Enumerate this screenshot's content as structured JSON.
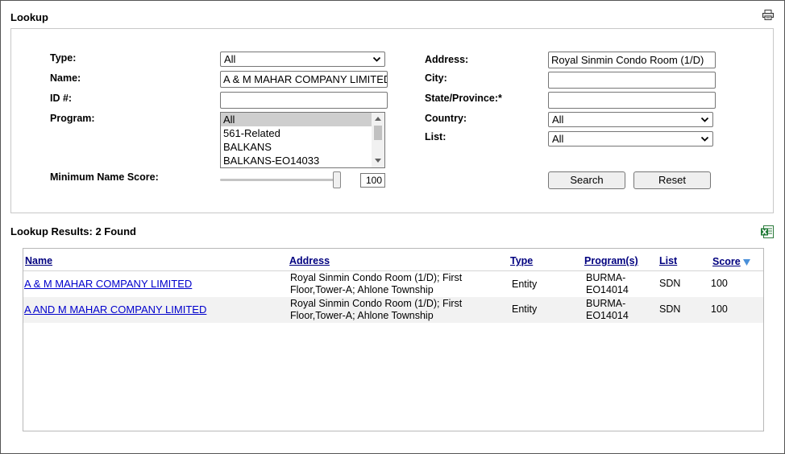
{
  "lookup": {
    "title": "Lookup",
    "icons": {
      "print": "print-icon"
    },
    "fields": {
      "type": {
        "label": "Type:",
        "value": "All"
      },
      "name": {
        "label": "Name:",
        "value": "A & M MAHAR COMPANY LIMITED"
      },
      "id": {
        "label": "ID #:",
        "value": ""
      },
      "program": {
        "label": "Program:",
        "options": [
          "All",
          "561-Related",
          "BALKANS",
          "BALKANS-EO14033"
        ],
        "selected": "All"
      },
      "min_score": {
        "label": "Minimum Name Score:",
        "value": "100",
        "level": 100
      },
      "address": {
        "label": "Address:",
        "value": "Royal Sinmin Condo Room (1/D)"
      },
      "city": {
        "label": "City:",
        "value": ""
      },
      "state": {
        "label": "State/Province:*",
        "value": ""
      },
      "country": {
        "label": "Country:",
        "value": "All"
      },
      "list": {
        "label": "List:",
        "value": "All"
      }
    },
    "buttons": {
      "search": "Search",
      "reset": "Reset"
    }
  },
  "results": {
    "title": "Lookup Results: 2 Found",
    "icons": {
      "export": "excel-icon"
    },
    "columns": [
      "Name",
      "Address",
      "Type",
      "Program(s)",
      "List",
      "Score"
    ],
    "sort_column": "Score",
    "rows": [
      {
        "name": "A & M MAHAR COMPANY LIMITED",
        "address_line1": "Royal Sinmin Condo Room (1/D); First",
        "address_line2": "Floor,Tower-A; Ahlone Township",
        "type": "Entity",
        "program_line1": "BURMA-",
        "program_line2": "EO14014",
        "list": "SDN",
        "score": "100"
      },
      {
        "name": "A AND M MAHAR COMPANY LIMITED",
        "address_line1": "Royal Sinmin Condo Room (1/D); First",
        "address_line2": "Floor,Tower-A; Ahlone Township",
        "type": "Entity",
        "program_line1": "BURMA-",
        "program_line2": "EO14014",
        "list": "SDN",
        "score": "100"
      }
    ]
  },
  "colors": {
    "link": "#0000cc",
    "header_link": "#00007f",
    "row_alt": "#f2f2f2",
    "sort_arrow": "#4a90d9"
  }
}
